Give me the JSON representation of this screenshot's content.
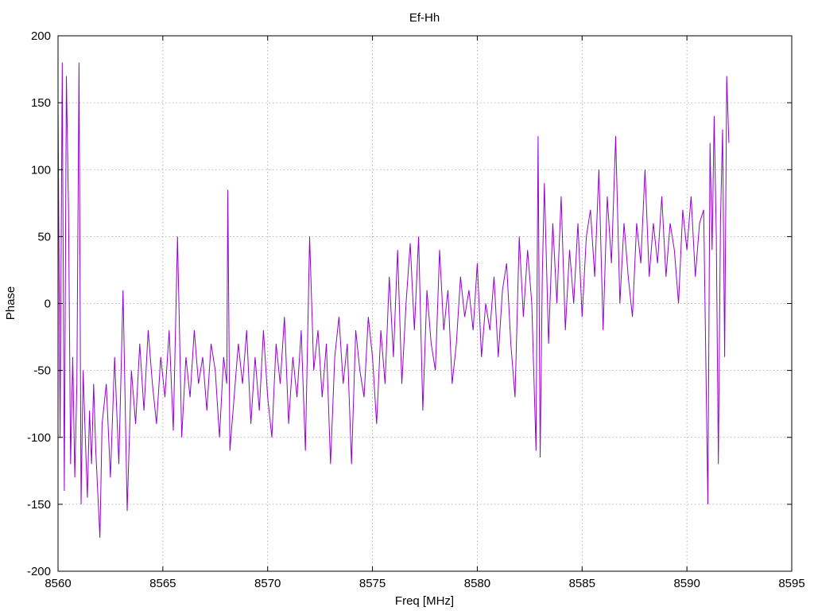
{
  "chart_data": {
    "type": "line",
    "title": "Ef-Hh",
    "xlabel": "Freq [MHz]",
    "ylabel": "Phase",
    "xlim": [
      8560,
      8595
    ],
    "ylim": [
      -200,
      200
    ],
    "xticks": [
      8560,
      8565,
      8570,
      8575,
      8580,
      8585,
      8590,
      8595
    ],
    "yticks": [
      200,
      150,
      100,
      50,
      0,
      -50,
      -100,
      -150,
      -200
    ],
    "grid": true,
    "legend": "none",
    "series": [
      {
        "color": "#9400d3",
        "x": [
          8560.0,
          8560.1,
          8560.2,
          8560.3,
          8560.4,
          8560.5,
          8560.6,
          8560.7,
          8560.8,
          8560.9,
          8561.0,
          8561.1,
          8561.2,
          8561.3,
          8561.4,
          8561.5,
          8561.6,
          8561.7,
          8561.8,
          8562.0,
          8562.1,
          8562.3,
          8562.5,
          8562.7,
          8562.9,
          8563.1,
          8563.3,
          8563.5,
          8563.7,
          8563.9,
          8564.1,
          8564.3,
          8564.5,
          8564.7,
          8564.9,
          8565.1,
          8565.3,
          8565.5,
          8565.7,
          8565.9,
          8566.1,
          8566.3,
          8566.5,
          8566.7,
          8566.9,
          8567.1,
          8567.3,
          8567.5,
          8567.7,
          8567.9,
          8568.05,
          8568.1,
          8568.2,
          8568.4,
          8568.6,
          8568.8,
          8569.0,
          8569.2,
          8569.4,
          8569.6,
          8569.8,
          8570.0,
          8570.2,
          8570.4,
          8570.6,
          8570.8,
          8571.0,
          8571.2,
          8571.4,
          8571.6,
          8571.8,
          8572.0,
          8572.2,
          8572.4,
          8572.6,
          8572.8,
          8573.0,
          8573.2,
          8573.4,
          8573.6,
          8573.8,
          8574.0,
          8574.2,
          8574.4,
          8574.6,
          8574.8,
          8575.0,
          8575.2,
          8575.4,
          8575.6,
          8575.8,
          8576.0,
          8576.2,
          8576.4,
          8576.6,
          8576.8,
          8577.0,
          8577.2,
          8577.4,
          8577.6,
          8577.8,
          8578.0,
          8578.2,
          8578.4,
          8578.6,
          8578.8,
          8579.0,
          8579.2,
          8579.4,
          8579.6,
          8579.8,
          8580.0,
          8580.2,
          8580.4,
          8580.6,
          8580.8,
          8581.0,
          8581.2,
          8581.4,
          8581.6,
          8581.8,
          8582.0,
          8582.2,
          8582.4,
          8582.6,
          8582.8,
          8582.9,
          8583.0,
          8583.1,
          8583.2,
          8583.4,
          8583.6,
          8583.8,
          8584.0,
          8584.2,
          8584.4,
          8584.6,
          8584.8,
          8585.0,
          8585.2,
          8585.4,
          8585.6,
          8585.8,
          8586.0,
          8586.2,
          8586.4,
          8586.6,
          8586.8,
          8587.0,
          8587.2,
          8587.4,
          8587.6,
          8587.8,
          8588.0,
          8588.2,
          8588.4,
          8588.6,
          8588.8,
          8589.0,
          8589.2,
          8589.4,
          8589.6,
          8589.8,
          8590.0,
          8590.2,
          8590.4,
          8590.6,
          8590.8,
          8591.0,
          8591.1,
          8591.2,
          8591.3,
          8591.4,
          8591.5,
          8591.6,
          8591.7,
          8591.8,
          8591.9,
          8592.0
        ],
        "y": [
          150,
          -100,
          180,
          -140,
          170,
          70,
          -120,
          -40,
          -130,
          -60,
          180,
          -150,
          -50,
          -100,
          -145,
          -80,
          -120,
          -60,
          -110,
          -175,
          -90,
          -60,
          -130,
          -40,
          -120,
          10,
          -155,
          -50,
          -90,
          -30,
          -80,
          -20,
          -60,
          -90,
          -40,
          -70,
          -20,
          -95,
          50,
          -100,
          -40,
          -70,
          -20,
          -60,
          -40,
          -80,
          -30,
          -50,
          -100,
          -40,
          -60,
          85,
          -110,
          -70,
          -30,
          -60,
          -20,
          -90,
          -40,
          -80,
          -20,
          -70,
          -100,
          -30,
          -60,
          -10,
          -90,
          -40,
          -70,
          -20,
          -110,
          50,
          -50,
          -20,
          -70,
          -30,
          -120,
          -40,
          -10,
          -60,
          -30,
          -120,
          -20,
          -50,
          -70,
          -10,
          -40,
          -90,
          -20,
          -60,
          20,
          -40,
          40,
          -60,
          0,
          45,
          -20,
          50,
          -80,
          10,
          -30,
          -50,
          40,
          -20,
          10,
          -60,
          -30,
          20,
          -10,
          10,
          -20,
          30,
          -40,
          0,
          -20,
          20,
          -40,
          10,
          30,
          -30,
          -70,
          50,
          -10,
          40,
          0,
          -110,
          125,
          -115,
          20,
          90,
          -30,
          60,
          0,
          80,
          -20,
          40,
          0,
          60,
          -10,
          50,
          70,
          20,
          100,
          -20,
          80,
          30,
          125,
          0,
          60,
          20,
          -10,
          60,
          30,
          100,
          20,
          60,
          30,
          80,
          20,
          60,
          40,
          0,
          70,
          40,
          80,
          20,
          60,
          70,
          -150,
          120,
          40,
          140,
          50,
          -120,
          60,
          130,
          -40,
          170,
          120
        ]
      }
    ]
  }
}
